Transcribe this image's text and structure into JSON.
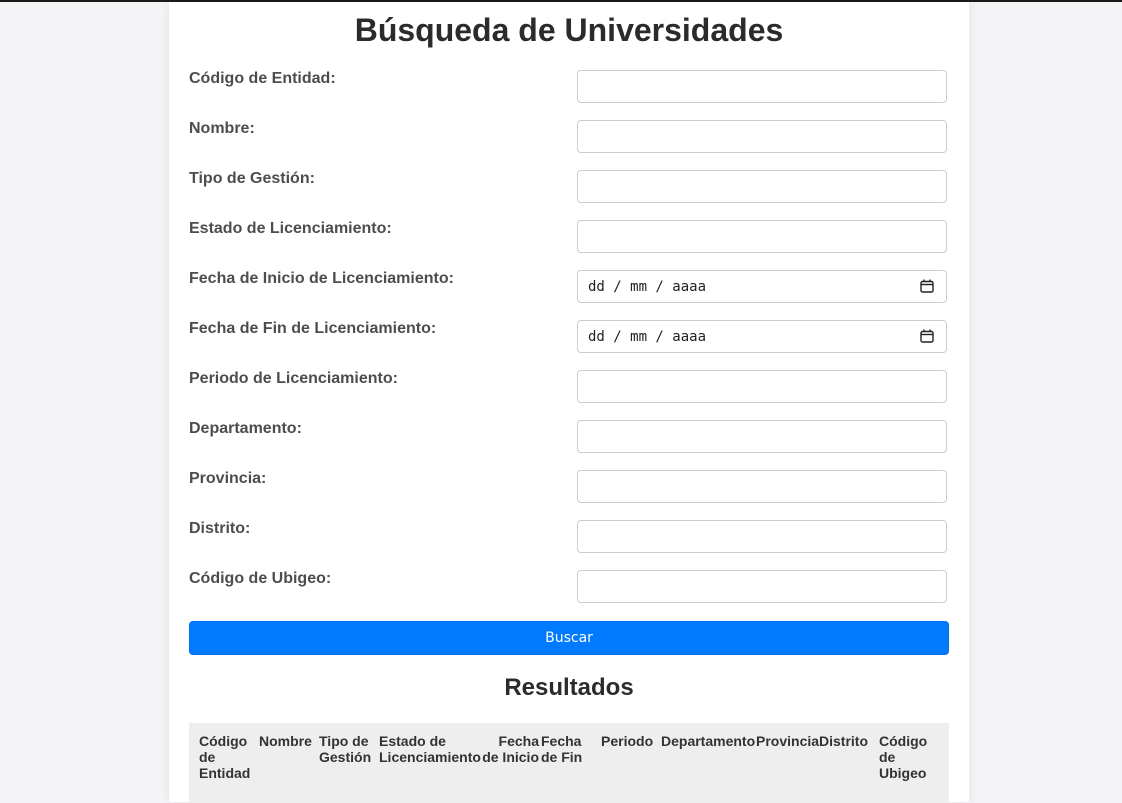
{
  "page": {
    "title": "Búsqueda de Universidades"
  },
  "form": {
    "fields": [
      {
        "label": "Código de Entidad:",
        "value": ""
      },
      {
        "label": "Nombre:",
        "value": ""
      },
      {
        "label": "Tipo de Gestión:",
        "value": ""
      },
      {
        "label": "Estado de Licenciamiento:",
        "value": ""
      },
      {
        "label": "Fecha de Inicio de Licenciamiento:",
        "value": "dd / mm / aaaa"
      },
      {
        "label": "Fecha de Fin de Licenciamiento:",
        "value": "dd / mm / aaaa"
      },
      {
        "label": "Periodo de Licenciamiento:",
        "value": ""
      },
      {
        "label": "Departamento:",
        "value": ""
      },
      {
        "label": "Provincia:",
        "value": ""
      },
      {
        "label": "Distrito:",
        "value": ""
      },
      {
        "label": "Código de Ubigeo:",
        "value": ""
      }
    ],
    "search_button": "Buscar"
  },
  "results": {
    "title": "Resultados",
    "columns": [
      "Código de Entidad",
      "Nombre",
      "Tipo de Gestión",
      "Estado de Licenciamiento",
      "Fecha de Inicio",
      "Fecha de Fin",
      "Periodo",
      "Departamento",
      "Provincia",
      "Distrito",
      "Código de Ubigeo"
    ]
  },
  "colors": {
    "accent": "#007bff",
    "background": "#f4f4f7",
    "table_header_bg": "#eeeeee"
  }
}
